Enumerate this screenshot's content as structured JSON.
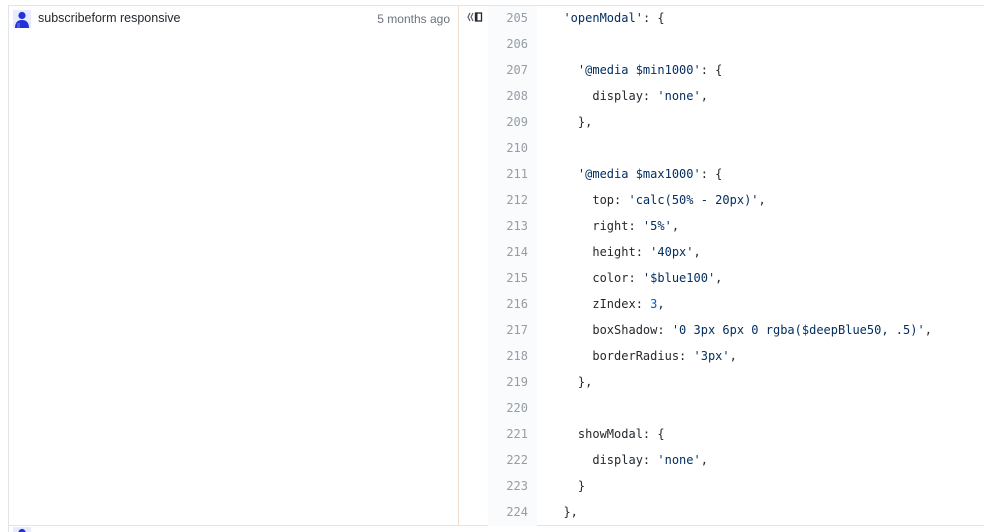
{
  "blame": {
    "commit_message": "subscribeform responsive",
    "commit_age": "5 months ago",
    "avatar_color": "#2132d8"
  },
  "code": {
    "lines": [
      {
        "num": "205",
        "text": "  'openModal': {"
      },
      {
        "num": "206",
        "text": ""
      },
      {
        "num": "207",
        "text": "    '@media $min1000': {"
      },
      {
        "num": "208",
        "text": "      display: 'none',"
      },
      {
        "num": "209",
        "text": "    },"
      },
      {
        "num": "210",
        "text": ""
      },
      {
        "num": "211",
        "text": "    '@media $max1000': {"
      },
      {
        "num": "212",
        "text": "      top: 'calc(50% - 20px)',"
      },
      {
        "num": "213",
        "text": "      right: '5%',"
      },
      {
        "num": "214",
        "text": "      height: '40px',"
      },
      {
        "num": "215",
        "text": "      color: '$blue100',"
      },
      {
        "num": "216",
        "text": "      zIndex: 3,"
      },
      {
        "num": "217",
        "text": "      boxShadow: '0 3px 6px 0 rgba($deepBlue50, .5)',"
      },
      {
        "num": "218",
        "text": "      borderRadius: '3px',"
      },
      {
        "num": "219",
        "text": "    },"
      },
      {
        "num": "220",
        "text": ""
      },
      {
        "num": "221",
        "text": "    showModal: {"
      },
      {
        "num": "222",
        "text": "      display: 'none',"
      },
      {
        "num": "223",
        "text": "    }"
      },
      {
        "num": "224",
        "text": "  },"
      }
    ]
  },
  "icons": {
    "reblame": "reblame-icon",
    "avatar": "user-avatar-icon"
  }
}
